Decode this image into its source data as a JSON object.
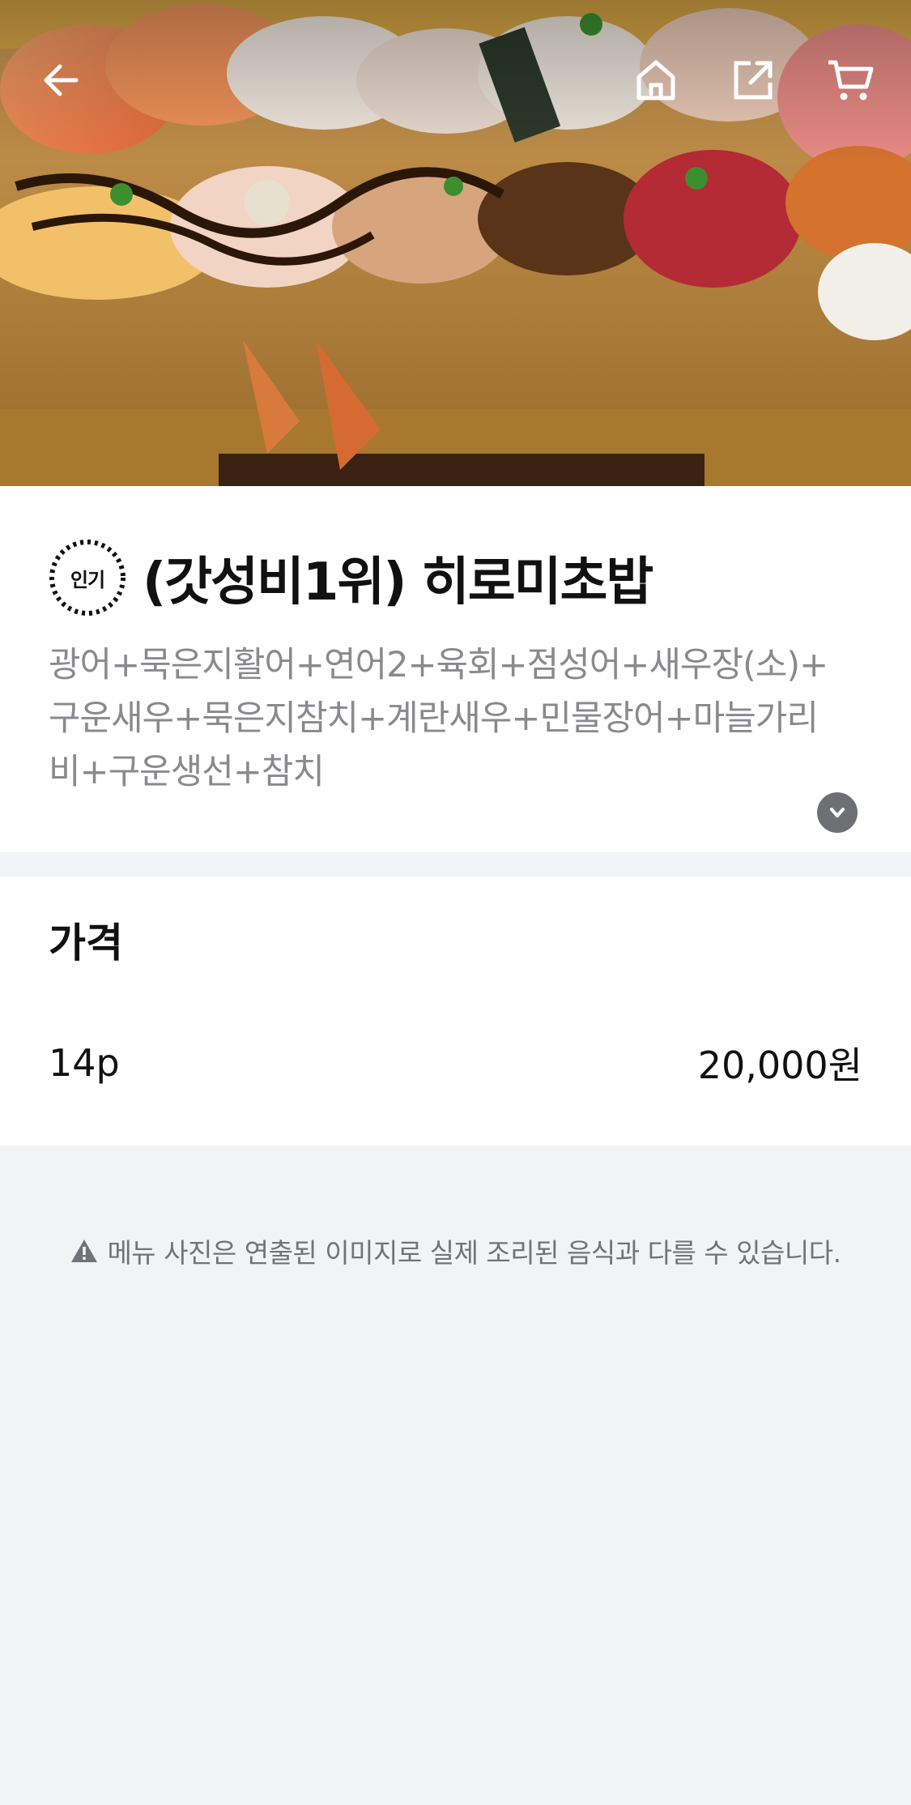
{
  "nav": {
    "back_icon": "arrow-left-icon",
    "home_icon": "home-icon",
    "share_icon": "share-icon",
    "cart_icon": "cart-icon"
  },
  "hero": {
    "image": "assorted nigiri sushi platter on wooden board"
  },
  "menu": {
    "badge": "인기",
    "title": "(갓성비1위) 히로미초밥",
    "description_lines": [
      "광어+묵은지활어+연어2+육회+점성어+새우장(소)+",
      "구운새우+묵은지참치+계란새우+민물장어+마늘가리",
      "비+구운생선+참치"
    ],
    "expand_icon": "chevron-down-icon"
  },
  "price": {
    "header": "가격",
    "options": [
      {
        "label": "14p",
        "value": "20,000원"
      }
    ]
  },
  "notice": {
    "icon": "warning-icon",
    "text": "메뉴 사진은 연출된 이미지로 실제 조리된 음식과 다를 수 있습니다."
  },
  "colors": {
    "background": "#f2f3f5",
    "card": "#ffffff",
    "muted_text": "#8a8a8e",
    "expand_button": "#6d6f73"
  }
}
